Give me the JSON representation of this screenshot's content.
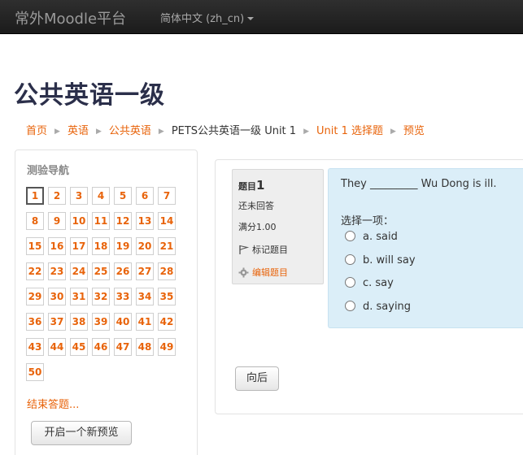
{
  "navbar": {
    "brand": "常外Moodle平台",
    "language": "简体中文 (zh_cn)"
  },
  "page_title": "公共英语一级",
  "breadcrumb": [
    {
      "label": "首页",
      "link": true
    },
    {
      "label": "英语",
      "link": true
    },
    {
      "label": "公共英语",
      "link": true
    },
    {
      "label": "PETS公共英语一级 Unit 1",
      "link": false
    },
    {
      "label": "Unit 1 选择题",
      "link": true
    },
    {
      "label": "预览",
      "link": true
    }
  ],
  "quiz_nav": {
    "title": "测验导航",
    "questions": [
      "1",
      "2",
      "3",
      "4",
      "5",
      "6",
      "7",
      "8",
      "9",
      "10",
      "11",
      "12",
      "13",
      "14",
      "15",
      "16",
      "17",
      "18",
      "19",
      "20",
      "21",
      "22",
      "23",
      "24",
      "25",
      "26",
      "27",
      "28",
      "29",
      "30",
      "31",
      "32",
      "33",
      "34",
      "35",
      "36",
      "37",
      "38",
      "39",
      "40",
      "41",
      "42",
      "43",
      "44",
      "45",
      "46",
      "47",
      "48",
      "49",
      "50"
    ],
    "current": "1",
    "finish_label": "结束答题...",
    "new_preview_label": "开启一个新预览"
  },
  "question": {
    "label": "题目",
    "number": "1",
    "state": "还未回答",
    "grade": "满分1.00",
    "flag_label": "标记题目",
    "edit_label": "编辑题目",
    "text": "They _________ Wu Dong is ill.",
    "prompt": "选择一项：",
    "answers": [
      "a. said",
      "b. will say",
      "c. say",
      "d. saying"
    ]
  },
  "prev_button": "向后",
  "colors": {
    "link": "#e8630a",
    "title": "#2b2f4a",
    "question_bg": "#dbeef8",
    "navbar": "#1b1b1b"
  }
}
